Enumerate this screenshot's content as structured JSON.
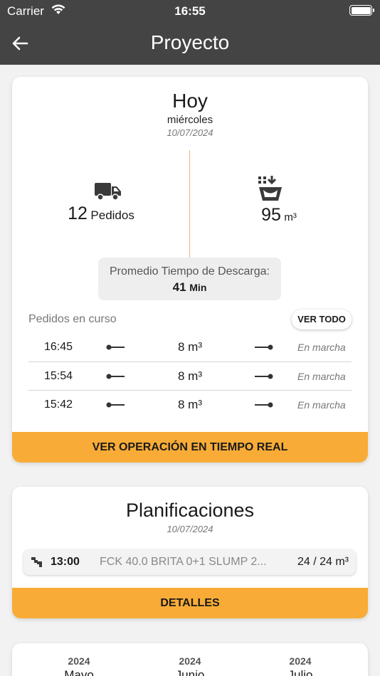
{
  "status": {
    "carrier": "Carrier",
    "time": "16:55"
  },
  "nav": {
    "title": "Proyecto"
  },
  "today": {
    "title": "Hoy",
    "weekday": "miércoles",
    "date": "10/07/2024",
    "orders_count": "12",
    "orders_label": "Pedidos",
    "volume": "95",
    "volume_unit": "m³",
    "avg_label": "Promedio Tiempo de Descarga:",
    "avg_value": "41",
    "avg_unit": "Min",
    "in_progress_label": "Pedidos en curso",
    "see_all": "VER TODO",
    "orders": [
      {
        "time": "16:45",
        "qty": "8 m³",
        "state": "En marcha"
      },
      {
        "time": "15:54",
        "qty": "8 m³",
        "state": "En marcha"
      },
      {
        "time": "15:42",
        "qty": "8 m³",
        "state": "En marcha"
      }
    ],
    "realtime_button": "VER OPERACIÓN EN TIEMPO REAL"
  },
  "planning": {
    "title": "Planificaciones",
    "date": "10/07/2024",
    "item": {
      "time": "13:00",
      "description": "FCK 40.0 BRITA 0+1 SLUMP 2...",
      "qty": "24 / 24 m³"
    },
    "details_button": "DETALLES"
  },
  "months": [
    {
      "year": "2024",
      "month": "Mayo"
    },
    {
      "year": "2024",
      "month": "Junio"
    },
    {
      "year": "2024",
      "month": "Julio"
    }
  ],
  "colors": {
    "header": "#444444",
    "accent": "#f8ac37",
    "divider": "#f0b77a"
  }
}
